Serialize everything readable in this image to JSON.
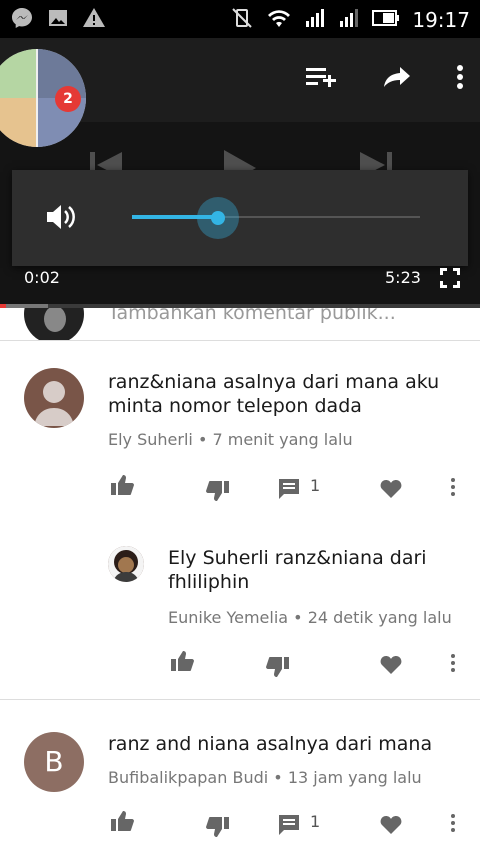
{
  "status_bar": {
    "time": "19:17",
    "icons": [
      "messenger-icon",
      "image-icon",
      "warning-icon",
      "vibrate-off-icon",
      "wifi-icon",
      "signal-icon",
      "signal-icon-2",
      "battery-icon"
    ]
  },
  "player": {
    "badge_count": "2",
    "current_time": "0:02",
    "duration": "5:23",
    "volume_level": 0.3,
    "progress_fraction": 0.006,
    "buffer_fraction": 0.1
  },
  "add_comment": {
    "placeholder": "Tambahkan komentar publik..."
  },
  "comments": [
    {
      "text": "ranz&niana asalnya dari mana aku minta nomor telepon dada",
      "author": "Ely Suherli",
      "time": "7 menit yang lalu",
      "reply_count": "1",
      "avatar_color": "#795548"
    },
    {
      "text": "Ely Suherli ranz&niana dari fhliliphin",
      "author": "Eunike Yemelia",
      "time": "24 detik yang lalu",
      "is_reply": true
    },
    {
      "text": "ranz and niana asalnya dari mana",
      "author": "Bufibalikpapan Budi",
      "time": "13 jam yang lalu",
      "reply_count": "1",
      "avatar_letter": "B",
      "avatar_color": "#8d6e63"
    }
  ],
  "separator": "•"
}
